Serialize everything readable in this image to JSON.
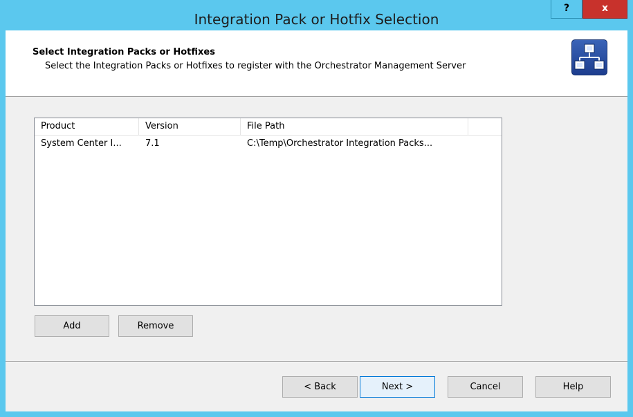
{
  "window": {
    "title": "Integration Pack or Hotfix Selection",
    "help_label": "?",
    "close_label": "x"
  },
  "header": {
    "title": "Select Integration Packs or Hotfixes",
    "subtitle": "Select the Integration Packs or Hotfixes to register with the Orchestrator Management Server",
    "icon": "integration-pack-icon"
  },
  "list": {
    "columns": [
      "Product",
      "Version",
      "File Path"
    ],
    "rows": [
      {
        "product": "System Center I...",
        "version": "7.1",
        "file_path": "C:\\Temp\\Orchestrator Integration Packs..."
      }
    ]
  },
  "list_buttons": {
    "add": "Add",
    "remove": "Remove"
  },
  "footer": {
    "back": "< Back",
    "next": "Next >",
    "cancel": "Cancel",
    "help": "Help"
  },
  "colors": {
    "titlebar": "#5bc8ee",
    "close": "#c8322c",
    "client": "#f0f0f0",
    "primary_border": "#0078d7"
  }
}
